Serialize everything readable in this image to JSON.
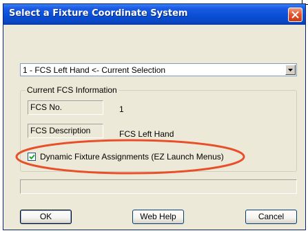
{
  "window": {
    "title": "Select a Fixture Coordinate System"
  },
  "fcs_select": {
    "selected_value": "1  -  FCS Left Hand  <- Current Selection"
  },
  "current_fcs": {
    "group_title": "Current FCS Information",
    "fcs_no_label": "FCS No.",
    "fcs_no_value": "1",
    "fcs_description_label": "FCS Description",
    "fcs_description_value": "FCS Left Hand"
  },
  "dynamic_assignments": {
    "label": "Dynamic Fixture Assignments (EZ Launch Menus)",
    "checked": true
  },
  "buttons": {
    "ok": "OK",
    "web_help": "Web Help",
    "cancel": "Cancel"
  },
  "colors": {
    "title_bar": "#0a4fd6",
    "dialog_background": "#ece9d8",
    "highlight_annotation": "#e8502a"
  },
  "icons": {
    "close": "close-icon",
    "dropdown": "chevron-down-icon",
    "checkbox": "checkmark-icon"
  }
}
